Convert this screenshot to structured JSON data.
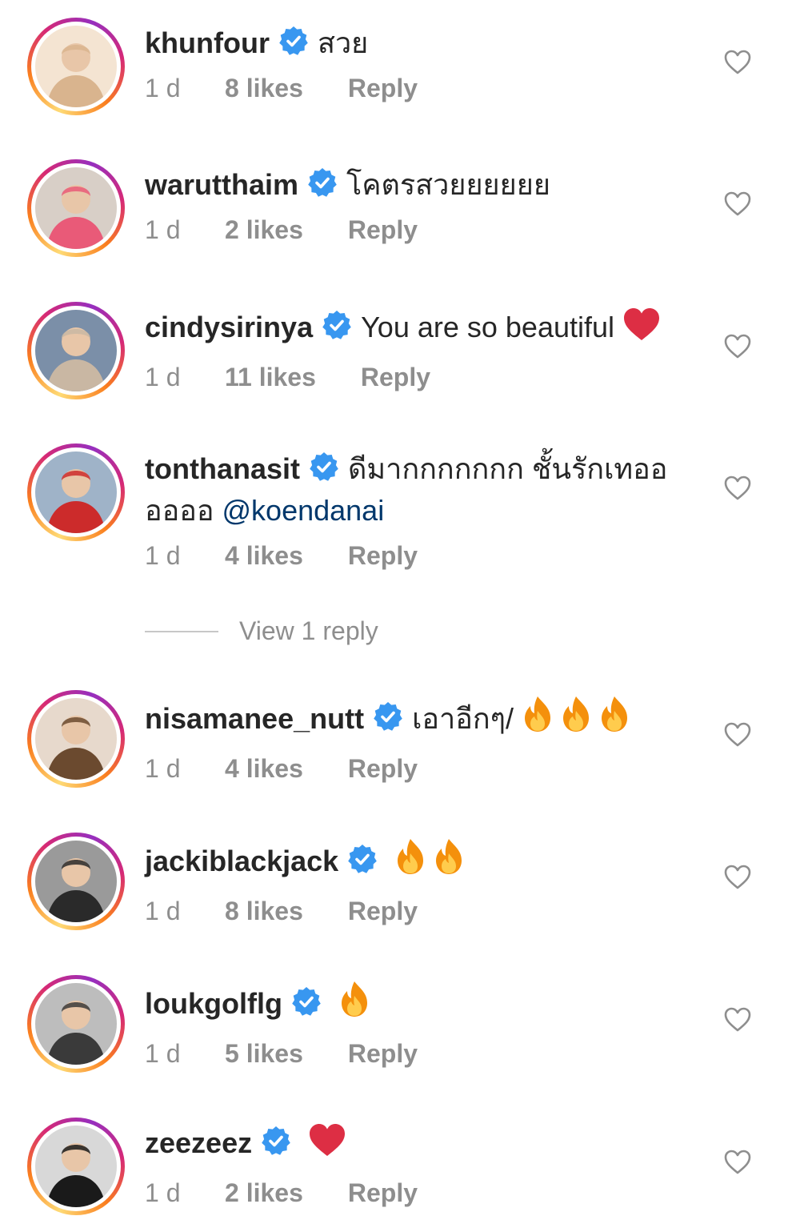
{
  "comments": [
    {
      "username": "khunfour",
      "text": "สวย",
      "emojis": [],
      "time": "1 d",
      "likes": "8 likes",
      "reply": "Reply",
      "avatar_colors": [
        "#d9b48e",
        "#f4e4d2"
      ]
    },
    {
      "username": "warutthaim",
      "text": "โคตรสวยยยยยย",
      "emojis": [],
      "time": "1 d",
      "likes": "2 likes",
      "reply": "Reply",
      "avatar_colors": [
        "#e95a78",
        "#d8cfc7"
      ]
    },
    {
      "username": "cindysirinya",
      "text": "You are so beautiful",
      "emojis": [
        "heart"
      ],
      "time": "1 d",
      "likes": "11 likes",
      "reply": "Reply",
      "avatar_colors": [
        "#c9b7a3",
        "#7b8fa8"
      ]
    },
    {
      "username": "tonthanasit",
      "text": "ดีมากกกกกกก ชั้นรักเทออ",
      "text2": "ออออ",
      "mention": "@koendanai",
      "emojis": [],
      "time": "1 d",
      "likes": "4 likes",
      "reply": "Reply",
      "avatar_colors": [
        "#cc2b2b",
        "#9fb3c8"
      ]
    },
    {
      "username": "nisamanee_nutt",
      "text": "เอาอีกๆ/",
      "emojis": [
        "fire",
        "fire",
        "fire"
      ],
      "time": "1 d",
      "likes": "4 likes",
      "reply": "Reply",
      "avatar_colors": [
        "#6b4a2f",
        "#e7d9cc"
      ]
    },
    {
      "username": "jackiblackjack",
      "text": "",
      "emojis": [
        "fire",
        "fire"
      ],
      "time": "1 d",
      "likes": "8 likes",
      "reply": "Reply",
      "avatar_colors": [
        "#2a2a2a",
        "#9a9a9a"
      ]
    },
    {
      "username": "loukgolflg",
      "text": "",
      "emojis": [
        "fire"
      ],
      "time": "1 d",
      "likes": "5 likes",
      "reply": "Reply",
      "avatar_colors": [
        "#3a3a3a",
        "#bdbdbd"
      ]
    },
    {
      "username": "zeezeez",
      "text": "",
      "emojis": [
        "heart"
      ],
      "time": "1 d",
      "likes": "2 likes",
      "reply": "Reply",
      "avatar_colors": [
        "#1a1a1a",
        "#d8d8d8"
      ]
    }
  ],
  "view_replies": "View 1 reply",
  "colors": {
    "verified_blue": "#3897f0",
    "heart_red": "#ed4956",
    "secondary_text": "#8e8e8e",
    "mention_blue": "#00376b"
  },
  "icons": {
    "verified": "verified-badge-icon",
    "like": "heart-outline-icon",
    "fire": "fire-emoji-icon",
    "heart": "red-heart-emoji-icon"
  }
}
